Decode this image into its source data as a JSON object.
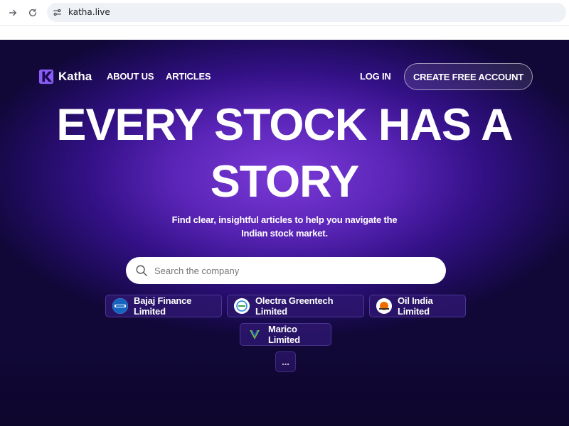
{
  "browser": {
    "url": "katha.live"
  },
  "brand": {
    "name": "Katha",
    "accent": "#8b5cf6"
  },
  "nav": {
    "about": "ABOUT US",
    "articles": "ARTICLES",
    "login": "LOG IN",
    "cta": "CREATE FREE ACCOUNT"
  },
  "hero": {
    "line1": "EVERY STOCK HAS A",
    "line2": "STORY",
    "subtitle_line1": "Find clear, insightful articles to help you navigate the",
    "subtitle_line2": "Indian stock market."
  },
  "search": {
    "placeholder": "Search the company"
  },
  "companies": [
    {
      "name": "Bajaj Finance Limited",
      "icon": "bajaj-logo-icon"
    },
    {
      "name": "Olectra Greentech Limited",
      "icon": "olectra-logo-icon"
    },
    {
      "name": "Oil India Limited",
      "icon": "oil-india-logo-icon"
    },
    {
      "name": "Marico Limited",
      "icon": "marico-logo-icon"
    }
  ],
  "more_label": "...",
  "colors": {
    "bg_center": "#7a3ad6",
    "bg_edge": "#110838",
    "chip_bg": "#2d166e"
  }
}
